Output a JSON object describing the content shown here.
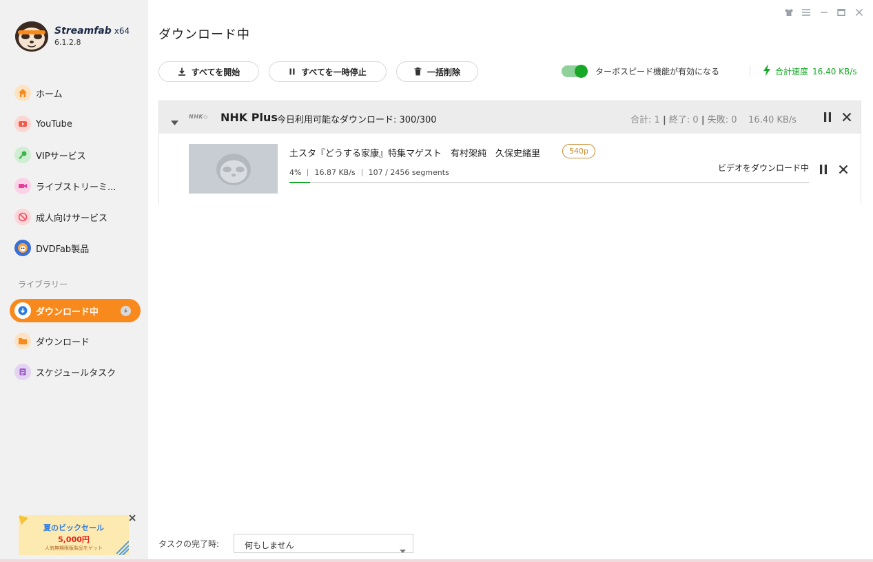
{
  "app": {
    "brand": "Streamfab",
    "arch": "x64",
    "version": "6.1.2.8"
  },
  "sidebar": {
    "items": [
      {
        "label": "ホーム",
        "icon": "home-icon",
        "color": "#f7a541"
      },
      {
        "label": "YouTube",
        "icon": "youtube-icon",
        "color": "#f05a4a"
      },
      {
        "label": "VIPサービス",
        "icon": "key-icon",
        "color": "#3bb54a"
      },
      {
        "label": "ライブストリーミ...",
        "icon": "video-camera-icon",
        "color": "#e83e9a"
      },
      {
        "label": "成人向けサービス",
        "icon": "adult-icon",
        "color": "#ef4e5e"
      },
      {
        "label": "DVDFab製品",
        "icon": "dvdfab-icon",
        "color": "#3a6fd8"
      }
    ],
    "section_label": "ライブラリー",
    "library": [
      {
        "label": "ダウンロード中",
        "icon": "download-icon",
        "active": true
      },
      {
        "label": "ダウンロード",
        "icon": "folder-icon",
        "active": false
      },
      {
        "label": "スケジュールタスク",
        "icon": "schedule-icon",
        "active": false
      }
    ],
    "promo": {
      "title": "夏のビックセール",
      "price": "5,000円",
      "sub": "人気無期限版製品をゲット"
    }
  },
  "main": {
    "title": "ダウンロード中",
    "toolbar": {
      "start_all": "すべてを開始",
      "pause_all": "すべてを一時停止",
      "delete_all": "一括削除"
    },
    "turbo": {
      "label": "ターボスピード機能が有効になる",
      "enabled": true
    },
    "total_speed": {
      "label": "合計速度",
      "value": "16.40 KB/s"
    },
    "group": {
      "logo": "NHK◇",
      "service": "NHK Plus",
      "quota": "今日利用可能なダウンロード: 300/300",
      "stats": {
        "total_label": "合計:",
        "total": "1",
        "done_label": "終了:",
        "done": "0",
        "failed_label": "失敗:",
        "failed": "0",
        "speed": "16.40 KB/s"
      },
      "items": [
        {
          "title": "土スタ『どうする家康』特集マゲスト　有村架純　久保史緒里",
          "quality": "540p",
          "percent": "4%",
          "progress": 0.04,
          "speed": "16.87 KB/s",
          "segments": "107 / 2456 segments",
          "status": "ビデオをダウンロード中"
        }
      ]
    },
    "footer": {
      "label": "タスクの完了時:",
      "option": "何もしません"
    }
  },
  "colors": {
    "accent": "#f7891d",
    "green": "#18a828",
    "quality": "#c98a2d"
  }
}
